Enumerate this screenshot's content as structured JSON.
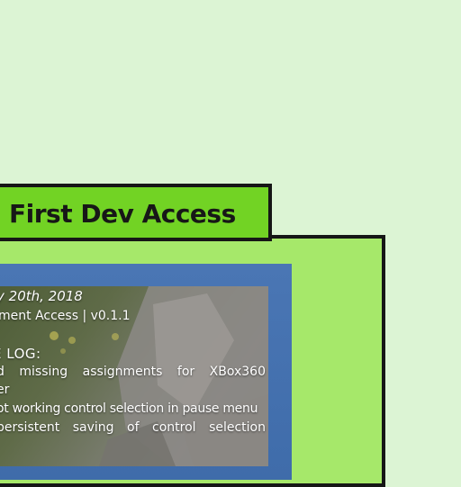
{
  "header": {
    "title": "First Dev Access"
  },
  "changelog": {
    "date": "y 20th, 2018",
    "access_version": "ment Access | v0.1.1",
    "heading": "E LOG:",
    "entries": [
      "d missing assignments for XBox360",
      "er",
      "ot working control selection in pause menu",
      "persistent saving of control selection"
    ]
  },
  "colors": {
    "background": "#dcf4d4",
    "title_tab": "#72d324",
    "panel": "#a6e86a",
    "frame": "#4a76b4",
    "border": "#161616"
  }
}
